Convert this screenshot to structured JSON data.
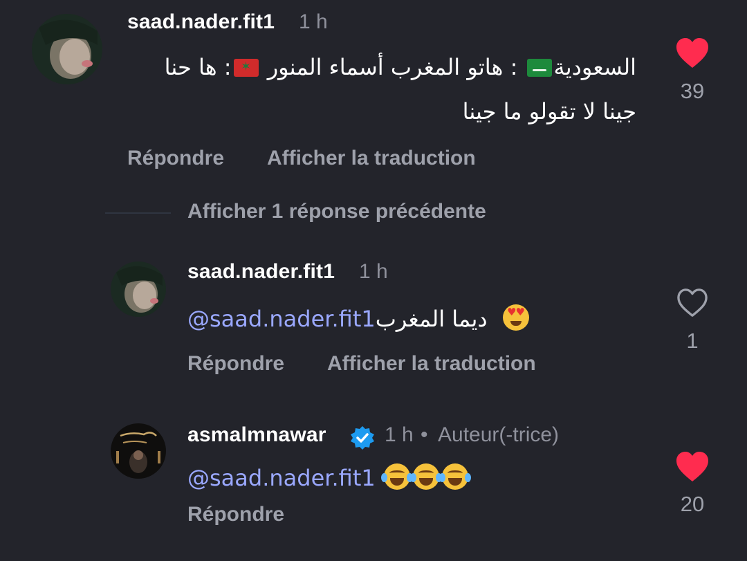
{
  "comments": [
    {
      "username": "saad.nader.fit1",
      "time": "1 h",
      "text_line1_a": "السعودية",
      "text_line1_b": " : هاتو المغرب  أسماء المنور ",
      "text_line1_c": ": ها حنا",
      "text_line2": "جينا لا تقولو ما جينا",
      "reply_label": "Répondre",
      "translate_label": "Afficher la traduction",
      "likes": "39",
      "liked": true
    }
  ],
  "thread": {
    "show_previous_label": "Afficher 1 réponse précédente"
  },
  "replies": [
    {
      "username": "saad.nader.fit1",
      "time": "1 h",
      "mention": "@saad.nader.fit1",
      "text": " ديما المغرب",
      "reply_label": "Répondre",
      "translate_label": "Afficher la traduction",
      "likes": "1",
      "liked": false
    },
    {
      "username": "asmalmnawar",
      "time": "1 h",
      "author_badge": "Auteur(-trice)",
      "separator": "•",
      "mention": "@saad.nader.fit1",
      "reply_label": "Répondre",
      "likes": "20",
      "liked": true
    }
  ],
  "colors": {
    "background": "#23242b",
    "mention": "#9aa8ff",
    "heart_liked": "#ff2c4f",
    "muted": "#9ea1ab",
    "verified": "#1d9bf0"
  },
  "icons": [
    "heart-filled-icon",
    "heart-outline-icon",
    "verified-badge-icon"
  ]
}
